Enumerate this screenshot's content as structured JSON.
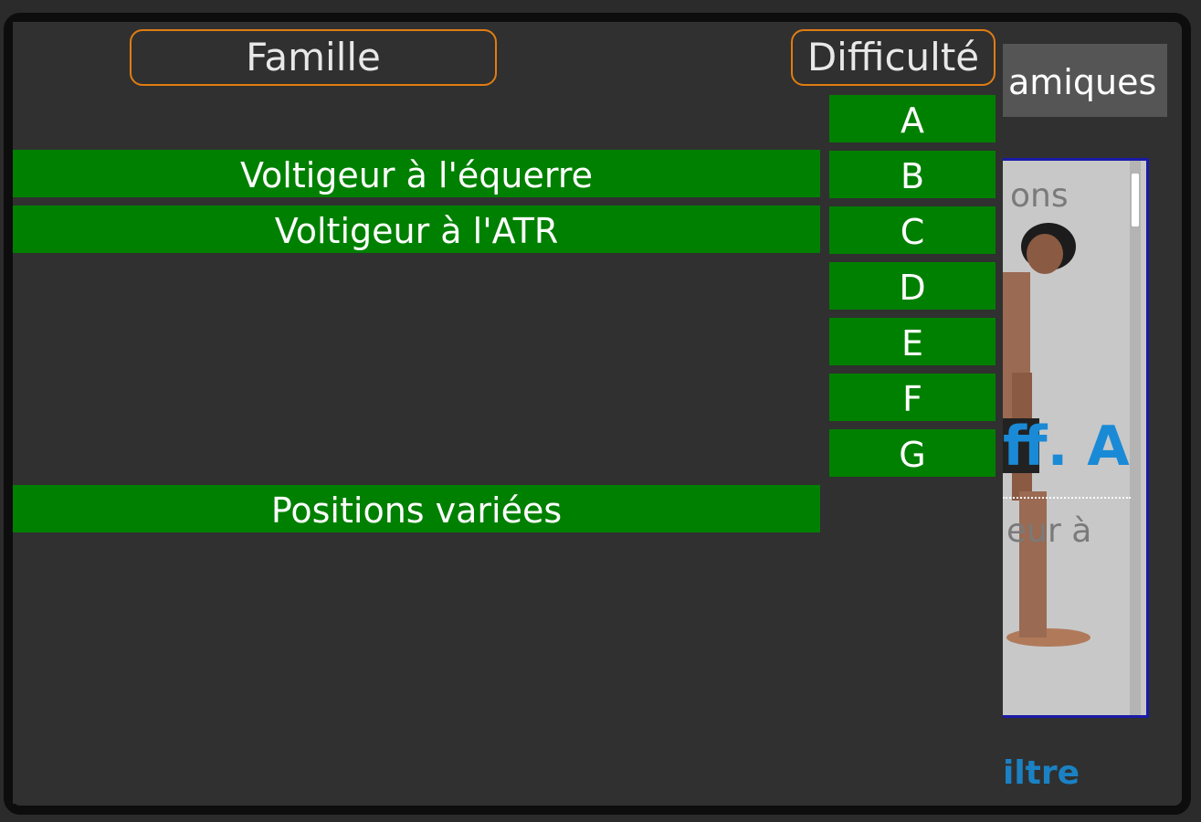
{
  "background": {
    "tab_label": "amiques",
    "card": {
      "top_text": "ons",
      "difficulty_text": "ff. A",
      "bottom_text": "eur à"
    },
    "filter_label": "iltre"
  },
  "popup": {
    "famille_label": "Famille",
    "difficulte_label": "Difficulté",
    "famille_items": [
      {
        "label": "",
        "slot": 0
      },
      {
        "label": "Voltigeur à l'équerre",
        "slot": 1
      },
      {
        "label": "Voltigeur à l'ATR",
        "slot": 2
      },
      {
        "label": "Positions variées",
        "slot": 6
      }
    ],
    "difficulty_items": [
      "A",
      "B",
      "C",
      "D",
      "E",
      "F",
      "G"
    ]
  },
  "colors": {
    "item_green": "#008000",
    "header_border": "#e07d12",
    "card_border": "#1a1aa8",
    "accent_blue": "#1a8ad6"
  }
}
